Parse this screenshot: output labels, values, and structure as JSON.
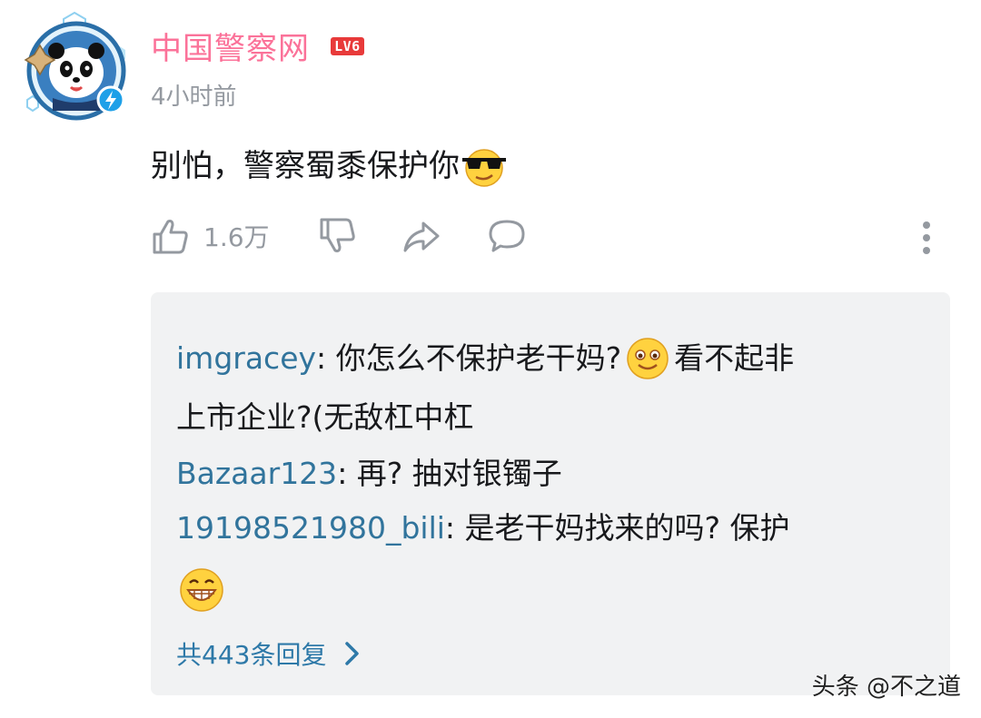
{
  "comment": {
    "author": "中国警察网",
    "level": "LV6",
    "time": "4小时前",
    "text": "别怕，警察蜀黍保护你",
    "like_count": "1.6万"
  },
  "replies": [
    {
      "user": "imgracey",
      "text_line1": ": 你怎么不保护老干妈? ",
      "text_line1_after_emoji": "看不起非",
      "text_line2": "上市企业?(无敌杠中杠"
    },
    {
      "user": "Bazaar123",
      "text": ": 再? 抽对银镯子"
    },
    {
      "user": "19198521980_bili",
      "text": ": 是老干妈找来的吗? 保护"
    }
  ],
  "more_replies_label": "共443条回复",
  "watermark": "头条 @不之道",
  "colors": {
    "username": "#fb7299",
    "reply_user": "#31749c",
    "level_badge": "#e83a3a",
    "meta": "#9499a0"
  },
  "icons": [
    "avatar-police-panda",
    "cool-sunglasses-emoji",
    "thumb-up-icon",
    "thumb-down-icon",
    "share-icon",
    "comment-icon",
    "more-vertical-icon",
    "smile-emoji",
    "grin-emoji",
    "chevron-right-icon"
  ]
}
